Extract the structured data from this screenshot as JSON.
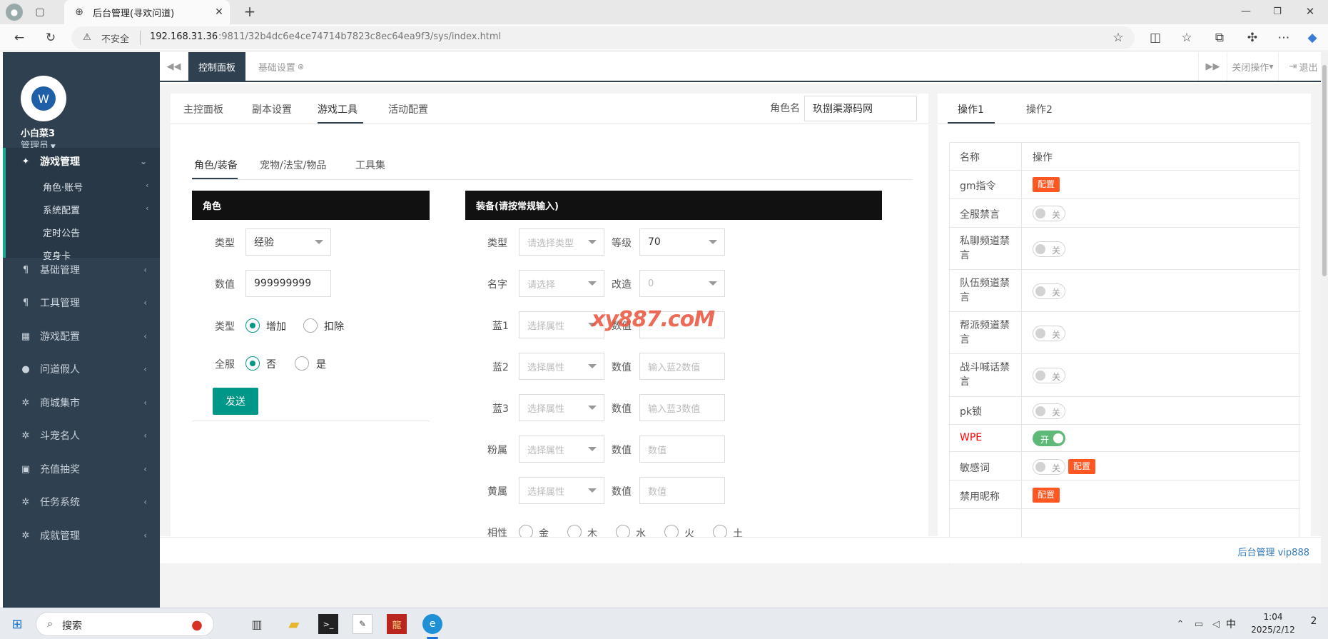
{
  "browser": {
    "tab_title": "后台管理(寻欢问道)",
    "new_tab": "+",
    "security": "不安全",
    "url_host": "192.168.31.36",
    "url_rest": ":9811/32b4dc6e4ce74714b7823c8ec64ea9f3/sys/index.html"
  },
  "sidebar": {
    "user_name": "小白菜3",
    "role": "管理员",
    "menu": [
      {
        "label": "游戏管理",
        "icon": "gamepad-icon",
        "glyph": "✦"
      },
      {
        "label": "基础管理",
        "icon": "cutlery-icon",
        "glyph": "¶"
      },
      {
        "label": "工具管理",
        "icon": "cutlery-icon",
        "glyph": "¶"
      },
      {
        "label": "游戏配置",
        "icon": "grid-icon",
        "glyph": "▦"
      },
      {
        "label": "问道假人",
        "icon": "user-icon",
        "glyph": "●"
      },
      {
        "label": "商城集市",
        "icon": "gear-icon",
        "glyph": "✲"
      },
      {
        "label": "斗宠名人",
        "icon": "gear-icon",
        "glyph": "✲"
      },
      {
        "label": "充值抽奖",
        "icon": "money-icon",
        "glyph": "▣"
      },
      {
        "label": "任务系统",
        "icon": "gear-icon",
        "glyph": "✲"
      },
      {
        "label": "成就管理",
        "icon": "gear-icon",
        "glyph": "✲"
      }
    ],
    "submenu": [
      "角色·账号",
      "系统配置",
      "定时公告",
      "变身卡"
    ]
  },
  "topnav": {
    "tabs": [
      "控制面板",
      "基础设置"
    ],
    "close_ops": "关闭操作",
    "logout": "退出"
  },
  "main": {
    "tabs": [
      "主控面板",
      "副本设置",
      "游戏工具",
      "活动配置"
    ],
    "role_name_label": "角色名",
    "role_name_value": "玖捌渠源码网",
    "subtabs": [
      "角色/装备",
      "宠物/法宝/物品",
      "工具集"
    ],
    "role_panel": {
      "title": "角色",
      "type_label": "类型",
      "type_value": "经验",
      "value_label": "数值",
      "value_value": "999999999",
      "op_label": "类型",
      "op_add": "增加",
      "op_sub": "扣除",
      "all_label": "全服",
      "all_no": "否",
      "all_yes": "是",
      "send": "发送"
    },
    "equip_panel": {
      "title": "装备(请按常规输入)",
      "type_label": "类型",
      "type_ph": "请选择类型",
      "level_label": "等级",
      "level_value": "70",
      "name_label": "名字",
      "name_ph": "请选择",
      "modify_label": "改造",
      "modify_value": "0",
      "rows": [
        {
          "label": "蓝1",
          "attr_ph": "选择属性",
          "val_label": "数值",
          "val_ph": ""
        },
        {
          "label": "蓝2",
          "attr_ph": "选择属性",
          "val_label": "数值",
          "val_ph": "输入蓝2数值"
        },
        {
          "label": "蓝3",
          "attr_ph": "选择属性",
          "val_label": "数值",
          "val_ph": "输入蓝3数值"
        },
        {
          "label": "粉属",
          "attr_ph": "选择属性",
          "val_label": "数值",
          "val_ph": "数值"
        },
        {
          "label": "黄属",
          "attr_ph": "选择属性",
          "val_label": "数值",
          "val_ph": "数值"
        }
      ],
      "affinity_label": "相性",
      "affinity": [
        "金",
        "木",
        "水",
        "火",
        "土"
      ]
    },
    "watermark": "xy887.coM"
  },
  "right": {
    "tabs": [
      "操作1",
      "操作2"
    ],
    "col_name": "名称",
    "col_op": "操作",
    "config_label": "配置",
    "off": "关",
    "on": "开",
    "accent_red": "#ff0000",
    "rows": [
      {
        "name": "gm指令"
      },
      {
        "name": "全服禁言"
      },
      {
        "name": "私聊频道禁言"
      },
      {
        "name": "队伍频道禁言"
      },
      {
        "name": "帮派频道禁言"
      },
      {
        "name": "战斗喊话禁言"
      },
      {
        "name": "pk锁"
      },
      {
        "name": "WPE"
      },
      {
        "name": "敏感词"
      },
      {
        "name": "禁用昵称"
      }
    ]
  },
  "footer": {
    "text": "后台管理 vip888"
  },
  "taskbar": {
    "search": "搜索",
    "time": "1:04",
    "date": "2025/2/12",
    "ime": "中",
    "notify": "2"
  },
  "colors": {
    "sidebar": "#2f4050",
    "teal": "#009688",
    "orange": "#ff5722",
    "green": "#5fb878"
  }
}
